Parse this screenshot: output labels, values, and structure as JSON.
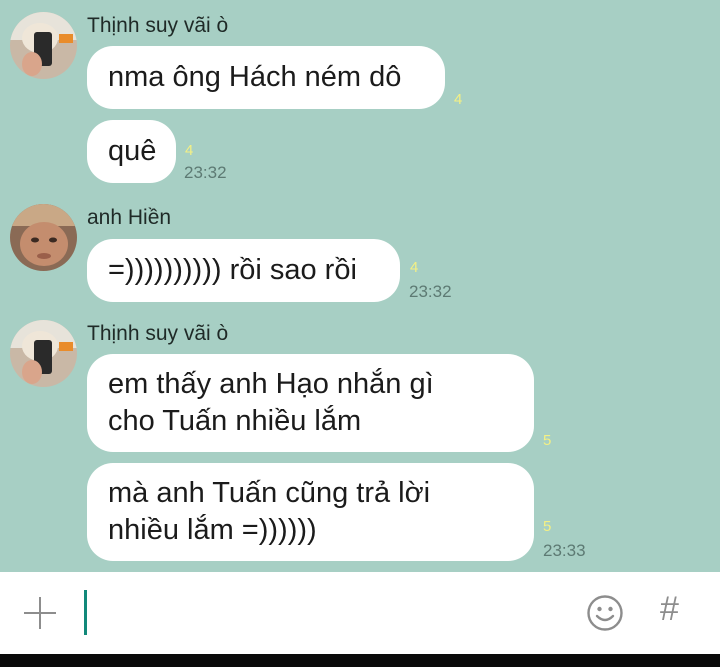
{
  "messages": [
    {
      "sender": "Thịnh suy vãi ò",
      "bubbles": [
        {
          "text": "nma ông Hách ném dô",
          "read": "4",
          "time": ""
        },
        {
          "text": "quê",
          "read": "4",
          "time": "23:32"
        }
      ]
    },
    {
      "sender": "anh Hiền",
      "bubbles": [
        {
          "text": "=)))))))))) rồi sao rồi",
          "read": "4",
          "time": "23:32"
        }
      ]
    },
    {
      "sender": "Thịnh suy vãi ò",
      "bubbles": [
        {
          "text": "em thấy anh Hạo nhắn gì\ncho Tuấn nhiều lắm",
          "read": "5",
          "time": ""
        },
        {
          "text": "mà anh Tuấn cũng trả lời\nnhiều lắm =))))))",
          "read": "5",
          "time": "23:33"
        }
      ]
    }
  ],
  "input": {
    "plus_icon": "plus-icon",
    "emoji_icon": "emoji-icon",
    "hash_label": "#"
  },
  "colors": {
    "background": "#a7cfc4",
    "bubble": "#ffffff",
    "read_count": "#f4f084",
    "caret": "#12897a"
  }
}
